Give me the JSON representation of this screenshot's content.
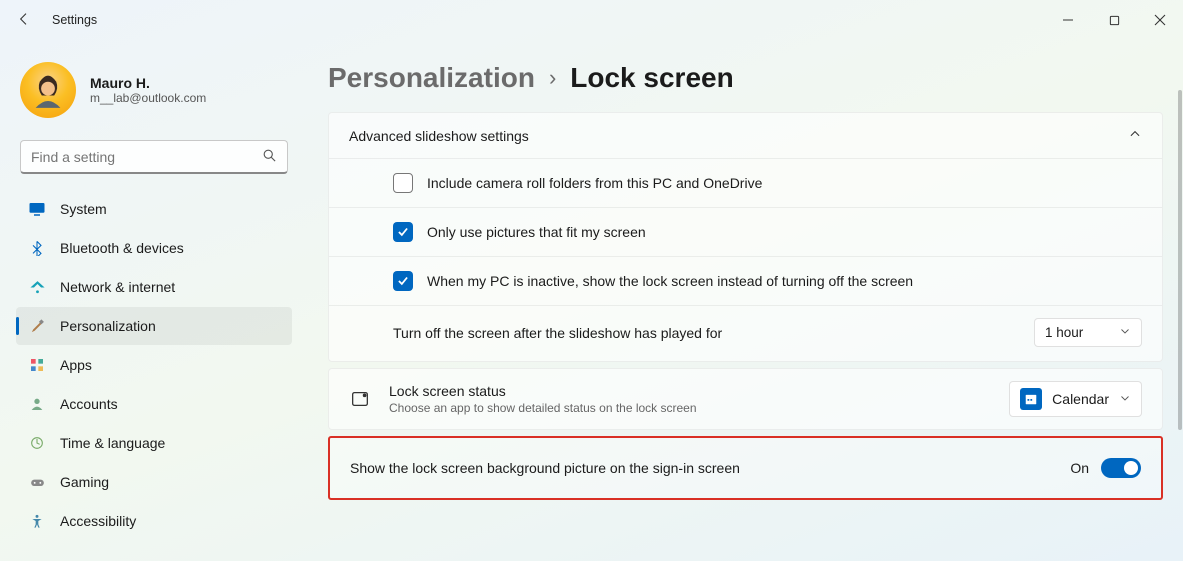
{
  "window": {
    "title": "Settings"
  },
  "profile": {
    "name": "Mauro H.",
    "email": "m__lab@outlook.com"
  },
  "search": {
    "placeholder": "Find a setting"
  },
  "sidebar": {
    "items": [
      {
        "label": "System"
      },
      {
        "label": "Bluetooth & devices"
      },
      {
        "label": "Network & internet"
      },
      {
        "label": "Personalization"
      },
      {
        "label": "Apps"
      },
      {
        "label": "Accounts"
      },
      {
        "label": "Time & language"
      },
      {
        "label": "Gaming"
      },
      {
        "label": "Accessibility"
      }
    ]
  },
  "breadcrumb": {
    "parent": "Personalization",
    "current": "Lock screen"
  },
  "advanced": {
    "title": "Advanced slideshow settings",
    "opt_camera_roll": "Include camera roll folders from this PC and OneDrive",
    "opt_fit": "Only use pictures that fit my screen",
    "opt_inactive": "When my PC is inactive, show the lock screen instead of turning off the screen",
    "turn_off_label": "Turn off the screen after the slideshow has played for",
    "turn_off_value": "1 hour"
  },
  "status": {
    "title": "Lock screen status",
    "subtitle": "Choose an app to show detailed status on the lock screen",
    "app": "Calendar"
  },
  "signin_bg": {
    "label": "Show the lock screen background picture on the sign-in screen",
    "state": "On"
  }
}
